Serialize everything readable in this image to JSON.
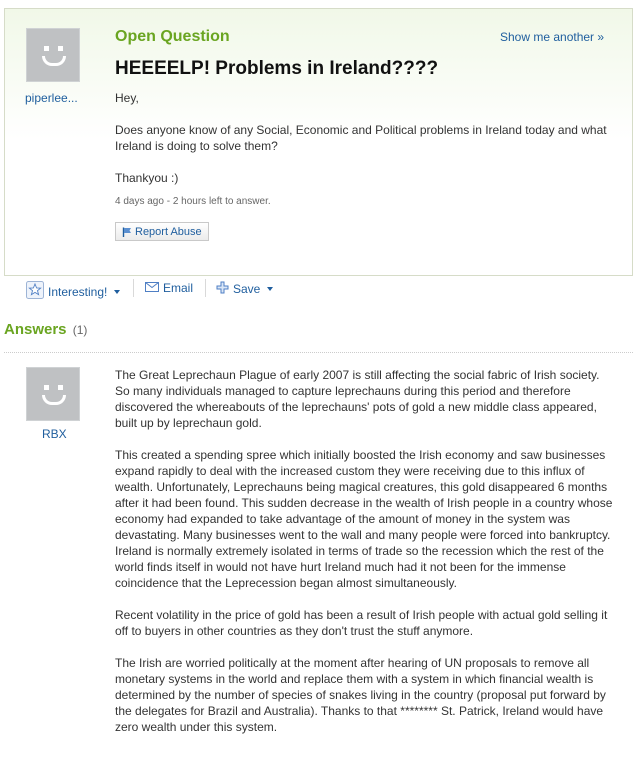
{
  "question": {
    "label": "Open Question",
    "show_another": "Show me another »",
    "title": "HEEEELP! Problems in Ireland????",
    "asker": "piperlee...",
    "body": [
      "Hey,",
      "Does anyone know of any Social, Economic and Political problems in Ireland today and what Ireland is doing to solve them?",
      "Thankyou :)"
    ],
    "meta": "4 days ago - 2 hours left to answer.",
    "report_label": "Report Abuse"
  },
  "actions": {
    "interesting": "Interesting!",
    "email": "Email",
    "save": "Save"
  },
  "answers": {
    "heading": "Answers",
    "count": "(1)",
    "items": [
      {
        "user": "RBX",
        "paragraphs": [
          "The Great Leprechaun Plague of early 2007 is still affecting the social fabric of Irish society. So many individuals managed to capture leprechauns during this period and therefore discovered the whereabouts of the leprechauns' pots of gold a new middle class appeared, built up by leprechaun gold.",
          "This created a spending spree which initially boosted the Irish economy and saw businesses expand rapidly to deal with the increased custom they were receiving due to this influx of wealth. Unfortunately, Leprechauns being magical creatures, this gold disappeared 6 months after it had been found. This sudden decrease in the wealth of Irish people in a country whose economy had expanded to take advantage of the amount of money in the system was devastating. Many businesses went to the wall and many people were forced into bankruptcy. Ireland is normally extremely isolated in terms of trade so the recession which the rest of the world finds itself in would not have hurt Ireland much had it not been for the immense coincidence that the Leprecession began almost simultaneously.",
          "Recent volatility in the price of gold has been a result of Irish people with actual gold selling it off to buyers in other countries as they don't trust the stuff anymore.",
          "The Irish are worried politically at the moment after hearing of UN proposals to remove all monetary systems in the world and replace them with a system in which financial wealth is determined by the number of species of snakes living in the country (proposal put forward by the delegates for Brazil and Australia). Thanks to that ******** St. Patrick, Ireland would have zero wealth under this system."
        ]
      }
    ]
  },
  "colors": {
    "accent_green": "#6aa521",
    "link_blue": "#1f5e9e",
    "avatar_gray": "#bfc1c3"
  }
}
